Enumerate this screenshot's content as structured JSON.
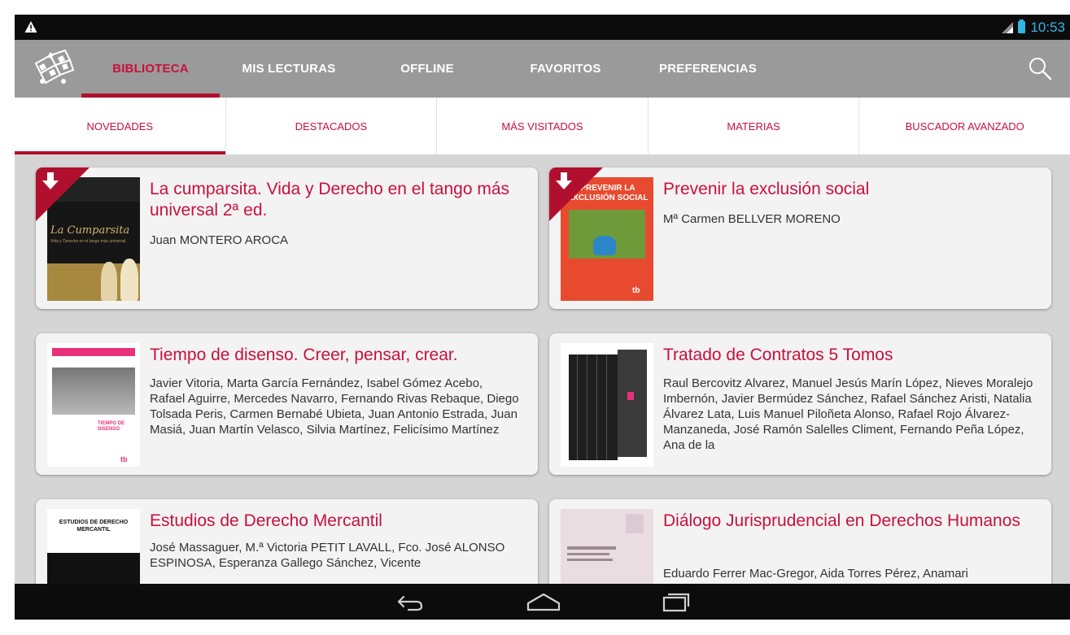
{
  "status_bar": {
    "time": "10:53",
    "warning_icon": "warning-icon",
    "signal_icon": "signal-3g-icon",
    "battery_icon": "battery-icon"
  },
  "action_bar": {
    "logo_icon": "library-logo-icon",
    "tabs": [
      {
        "label": "BIBLIOTECA",
        "active": true
      },
      {
        "label": "MIS LECTURAS",
        "active": false
      },
      {
        "label": "OFFLINE",
        "active": false
      },
      {
        "label": "FAVORITOS",
        "active": false
      },
      {
        "label": "PREFERENCIAS",
        "active": false
      }
    ],
    "search_icon": "search-icon"
  },
  "sub_tabs": [
    {
      "label": "NOVEDADES",
      "active": true
    },
    {
      "label": "DESTACADOS",
      "active": false
    },
    {
      "label": "MÁS VISITADOS",
      "active": false
    },
    {
      "label": "MATERIAS",
      "active": false
    },
    {
      "label": "BUSCADOR AVANZADO",
      "active": false
    }
  ],
  "books": [
    {
      "title": "La cumparsita. Vida y Derecho en el tango más universal 2ª ed.",
      "authors": "Juan MONTERO AROCA",
      "download_badge": true,
      "cover_text": {
        "script": "La Cumparsita",
        "sub": "Vida y Derecho en el tango más universal"
      }
    },
    {
      "title": "Prevenir la exclusión social",
      "authors": "Mª Carmen BELLVER MORENO",
      "download_badge": true,
      "cover_text": {
        "top": "PREVENIR LA EXCLUSIÓN SOCIAL",
        "badge": "tb"
      }
    },
    {
      "title": "Tiempo de disenso. Creer, pensar, crear.",
      "authors": "Javier Vitoria,  Marta García Fernández,  Isabel Gómez Acebo, Rafael Aguirre,  Mercedes Navarro,  Fernando Rivas Rebaque, Diego Tolsada Peris,  Carmen Bernabé Ubieta,  Juan Antonio Estrada,  Juan Masiá,  Juan Martín Velasco, Silvia Martínez,  Felicísimo Martínez",
      "download_badge": false,
      "cover_text": {
        "top": "TIEMPO DE DISENSO",
        "bottom": "tb"
      }
    },
    {
      "title": "Tratado de Contratos 5 Tomos",
      "authors": "Raul Bercovitz Alvarez, Manuel Jesús Marín López, Nieves Moralejo Imbernón,  Javier Bermúdez Sánchez, Rafael Sánchez Aristi, Natalia Álvarez Lata, Luis Manuel Piloñeta Alonso, Rafael Rojo Álvarez-Manzaneda,  José Ramón Salelles Climent, Fernando Peña López, Ana de la",
      "download_badge": false,
      "cover_text": {}
    },
    {
      "title": "Estudios de Derecho Mercantil",
      "authors": "José Massaguer, M.ª Victoria PETIT LAVALL, Fco. José ALONSO ESPINOSA, Esperanza Gallego Sánchez, Vicente",
      "download_badge": false,
      "cover_text": {
        "top": "ESTUDIOS DE DERECHO MERCANTIL"
      }
    },
    {
      "title": "Diálogo Jurisprudencial en Derechos Humanos",
      "authors": "Eduardo Ferrer Mac-Gregor, Aida Torres Pérez, Anamari",
      "download_badge": false,
      "cover_text": {}
    }
  ],
  "nav_bar": {
    "back_icon": "back-icon",
    "home_icon": "home-icon",
    "recents_icon": "recent-apps-icon"
  }
}
